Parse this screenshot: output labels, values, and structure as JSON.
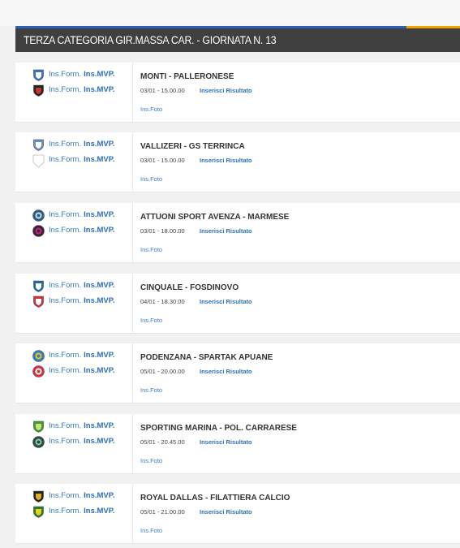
{
  "header": {
    "title": "TERZA CATEGORIA GIR.MASSA CAR. - GIORNATA N. 13",
    "colors": {
      "bar": "#3f3f3f",
      "accent_blue": "#2b62b6",
      "accent_orange": "#f0a500"
    }
  },
  "labels": {
    "ins_form": "Ins.Form.",
    "ins_mvp": "Ins.MVP.",
    "inserisci_risultato": "Inserisci Risultato",
    "ins_foto": "Ins.Foto"
  },
  "matches": [
    {
      "title": "MONTI - PALLERONESE",
      "datetime": "03/01 - 15.00.00",
      "home_logo": "shield-crest-icon",
      "away_logo": "shield-crest-icon",
      "home_colors": [
        "#3b73c5",
        "#ffffff"
      ],
      "away_colors": [
        "#222222",
        "#c0392b"
      ]
    },
    {
      "title": "VALLIZERI - GS TERRINCA",
      "datetime": "03/01 - 15.00.00",
      "home_logo": "shield-crest-icon",
      "away_logo": "blank-shield-icon",
      "home_colors": [
        "#6a8fc7",
        "#ffffff"
      ],
      "away_colors": [
        "#ffffff",
        "#cccccc"
      ]
    },
    {
      "title": "ATTUONI SPORT AVENZA - MARMESE",
      "datetime": "03/01 - 18.00.00",
      "home_logo": "round-crest-icon",
      "away_logo": "round-crest-icon",
      "home_colors": [
        "#2b5e8e",
        "#d0d8e0"
      ],
      "away_colors": [
        "#3b1d3d",
        "#c02c7a"
      ]
    },
    {
      "title": "CINQUALE - FOSDINOVO",
      "datetime": "04/01 - 18.30.00",
      "home_logo": "shield-crest-icon",
      "away_logo": "shield-crest-icon",
      "home_colors": [
        "#1e6ab3",
        "#ffffff"
      ],
      "away_colors": [
        "#d0303a",
        "#ffffff"
      ]
    },
    {
      "title": "PODENZANA - SPARTAK APUANE",
      "datetime": "05/01 - 20.00.00",
      "home_logo": "round-crest-icon",
      "away_logo": "round-crest-icon",
      "home_colors": [
        "#2f7fc0",
        "#f2c21b"
      ],
      "away_colors": [
        "#d93040",
        "#ffffff"
      ]
    },
    {
      "title": "SPORTING MARINA - POL. CARRARESE",
      "datetime": "05/01 - 20.45.00",
      "home_logo": "shield-crest-icon",
      "away_logo": "round-crest-icon",
      "home_colors": [
        "#3d9b3a",
        "#c8e66a"
      ],
      "away_colors": [
        "#1f4f3f",
        "#9fbfb0"
      ]
    },
    {
      "title": "ROYAL DALLAS - FILATTIERA CALCIO",
      "datetime": "05/01 - 21.00.00",
      "home_logo": "shield-crest-icon",
      "away_logo": "shield-crest-icon",
      "home_colors": [
        "#222222",
        "#e0b020"
      ],
      "away_colors": [
        "#2f7a2a",
        "#e6d21a"
      ]
    }
  ]
}
